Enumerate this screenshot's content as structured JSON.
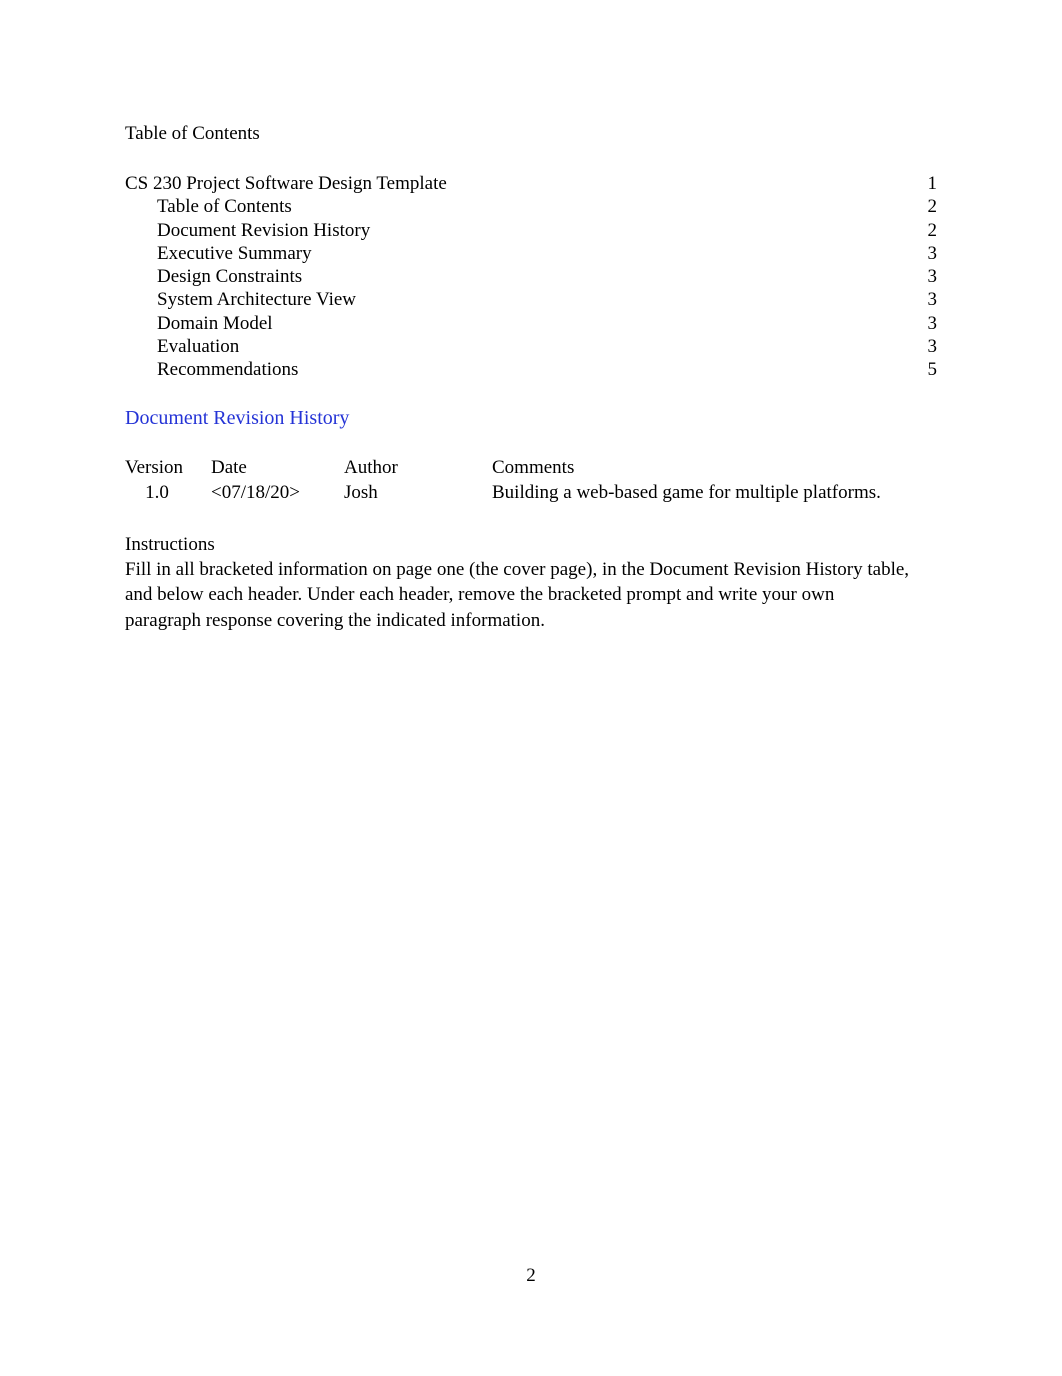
{
  "document": {
    "toc_heading": "Table of Contents",
    "page_number": "2"
  },
  "toc": {
    "entries": [
      {
        "label": "CS 230 Project Software Design Template",
        "page": "1",
        "level": 1
      },
      {
        "label": "Table of Contents",
        "page": "2",
        "level": 2
      },
      {
        "label": "Document Revision History",
        "page": "2",
        "level": 2
      },
      {
        "label": "Executive Summary",
        "page": "3",
        "level": 2
      },
      {
        "label": "Design Constraints",
        "page": "3",
        "level": 2
      },
      {
        "label": "System Architecture View",
        "page": "3",
        "level": 2
      },
      {
        "label": "Domain Model",
        "page": "3",
        "level": 2
      },
      {
        "label": "Evaluation",
        "page": "3",
        "level": 2
      },
      {
        "label": "Recommendations",
        "page": "5",
        "level": 2
      }
    ]
  },
  "revision_section": {
    "heading": "Document Revision History",
    "heading_color": "#2433d6",
    "columns": [
      "Version",
      "Date",
      "Author",
      "Comments"
    ],
    "rows": [
      {
        "version": "1.0",
        "date": "<07/18/20>",
        "author": "Josh",
        "comments": "Building a web-based game for multiple platforms."
      }
    ]
  },
  "instructions": {
    "title": "Instructions",
    "body": "Fill in all bracketed information on page one (the cover page), in the Document Revision History table, and below each header. Under each header, remove the bracketed prompt and write your own paragraph response covering the indicated information."
  }
}
